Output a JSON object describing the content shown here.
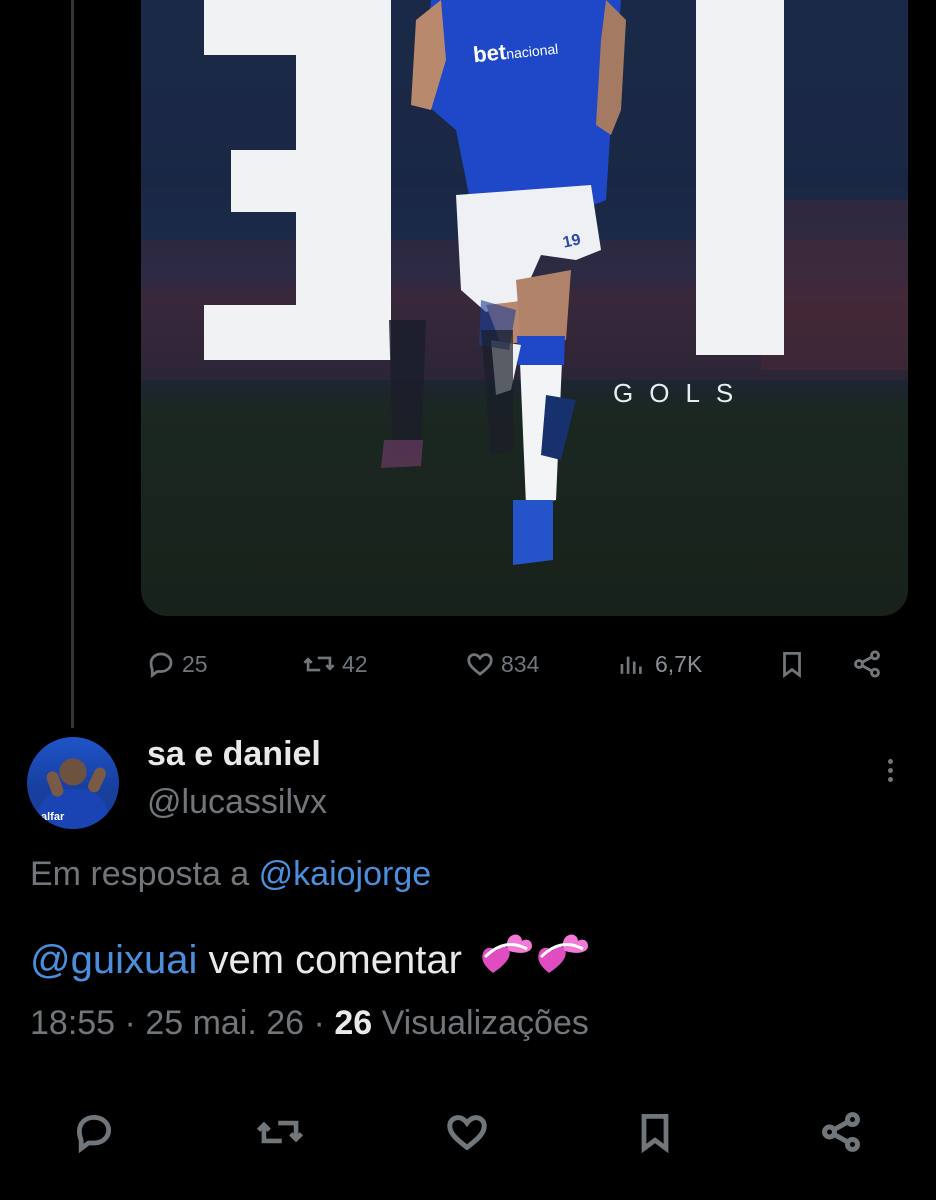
{
  "media": {
    "headline_number": "31",
    "headline_unit": "GOLS",
    "jersey_sponsor": "bet",
    "jersey_sponsor_suffix": "nacional",
    "shorts_number": "19"
  },
  "actions": {
    "replies": "25",
    "reposts": "42",
    "likes": "834",
    "views": "6,7K"
  },
  "reply": {
    "display_name": "sa e daniel",
    "handle": "@lucassilvx",
    "avatar_text": "alfar",
    "reply_prefix": "Em resposta a",
    "reply_target": "@kaiojorge",
    "mention": "@guixuai",
    "text": "vem comentar",
    "time": "18:55",
    "date": "25 mai. 26",
    "separator": "·",
    "view_count": "26",
    "view_label": "Visualizações"
  },
  "icons": {
    "reply": "comment-icon",
    "repost": "repost-icon",
    "like": "heart-icon",
    "views": "analytics-icon",
    "bookmark": "bookmark-icon",
    "share": "share-icon",
    "more": "more-vertical-icon",
    "emoji": "revolving-hearts-emoji"
  },
  "colors": {
    "background": "#000000",
    "text_primary": "#e7e9ea",
    "text_secondary": "#71767b",
    "link": "#4b8edb",
    "jersey_blue": "#1f48c8"
  }
}
